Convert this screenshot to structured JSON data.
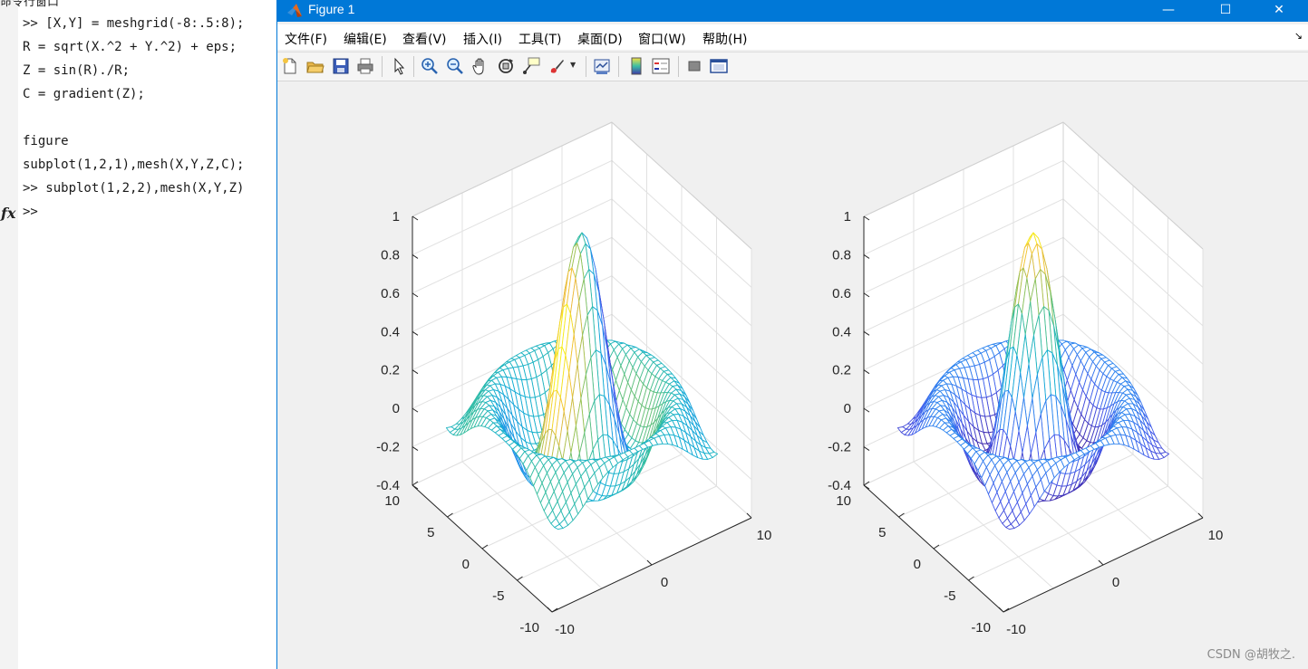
{
  "command_window": {
    "title": "命令行窗口",
    "lines": [
      ">> [X,Y] = meshgrid(-8:.5:8);",
      "R = sqrt(X.^2 + Y.^2) + eps;",
      "Z = sin(R)./R;",
      "C = gradient(Z);",
      "",
      "figure",
      "subplot(1,2,1),mesh(X,Y,Z,C);",
      ">> subplot(1,2,2),mesh(X,Y,Z)",
      ">>"
    ],
    "fx_symbol": "fx"
  },
  "figure_window": {
    "title": "Figure 1",
    "controls": {
      "minimize": "—",
      "maximize": "☐",
      "close": "✕"
    },
    "menu": [
      "文件(F)",
      "编辑(E)",
      "查看(V)",
      "插入(I)",
      "工具(T)",
      "桌面(D)",
      "窗口(W)",
      "帮助(H)"
    ],
    "toolbar_icons": [
      "new-figure-icon",
      "open-file-icon",
      "save-icon",
      "print-icon",
      "pointer-icon",
      "zoom-in-icon",
      "zoom-out-icon",
      "pan-icon",
      "rotate-3d-icon",
      "data-cursor-icon",
      "brush-icon",
      "link-plot-icon",
      "colorbar-icon",
      "legend-icon",
      "hide-plot-tools-icon",
      "show-plot-tools-icon"
    ]
  },
  "chart_data": [
    {
      "type": "mesh",
      "function": "Z = sin(R)./R, R = sqrt(X.^2 + Y.^2) + eps",
      "x": {
        "range": [
          -8,
          8
        ],
        "step": 0.5,
        "ticks": [
          -10,
          0,
          10
        ],
        "tick_labels": [
          "-10",
          "0",
          "10"
        ]
      },
      "y": {
        "range": [
          -8,
          8
        ],
        "step": 0.5,
        "ticks": [
          -10,
          -5,
          0,
          5,
          10
        ],
        "tick_labels": [
          "-10",
          "-5",
          "0",
          "5",
          "10"
        ]
      },
      "z": {
        "lim": [
          -0.4,
          1
        ],
        "ticks": [
          -0.4,
          -0.2,
          0,
          0.2,
          0.4,
          0.6,
          0.8,
          1
        ],
        "tick_labels": [
          "-0.4",
          "-0.2",
          "0",
          "0.2",
          "0.4",
          "0.6",
          "0.8",
          "1"
        ]
      },
      "coloring": "gradient(Z)",
      "grid": true,
      "view": "default 3-D (az -37.5, el 30)"
    },
    {
      "type": "mesh",
      "function": "Z = sin(R)./R, R = sqrt(X.^2 + Y.^2) + eps",
      "x": {
        "range": [
          -8,
          8
        ],
        "step": 0.5,
        "ticks": [
          -10,
          0,
          10
        ],
        "tick_labels": [
          "-10",
          "0",
          "10"
        ]
      },
      "y": {
        "range": [
          -8,
          8
        ],
        "step": 0.5,
        "ticks": [
          -10,
          -5,
          0,
          5,
          10
        ],
        "tick_labels": [
          "-10",
          "-5",
          "0",
          "5",
          "10"
        ]
      },
      "z": {
        "lim": [
          -0.4,
          1
        ],
        "ticks": [
          -0.4,
          -0.2,
          0,
          0.2,
          0.4,
          0.6,
          0.8,
          1
        ],
        "tick_labels": [
          "-0.4",
          "-0.2",
          "0",
          "0.2",
          "0.4",
          "0.6",
          "0.8",
          "1"
        ]
      },
      "coloring": "Z",
      "grid": true,
      "view": "default 3-D (az -37.5, el 30)"
    }
  ],
  "colors": {
    "titlebar": "#0078d7",
    "plot_bg": "#ffffff",
    "figure_bg": "#f0f0f0"
  },
  "watermark": "CSDN @胡牧之."
}
